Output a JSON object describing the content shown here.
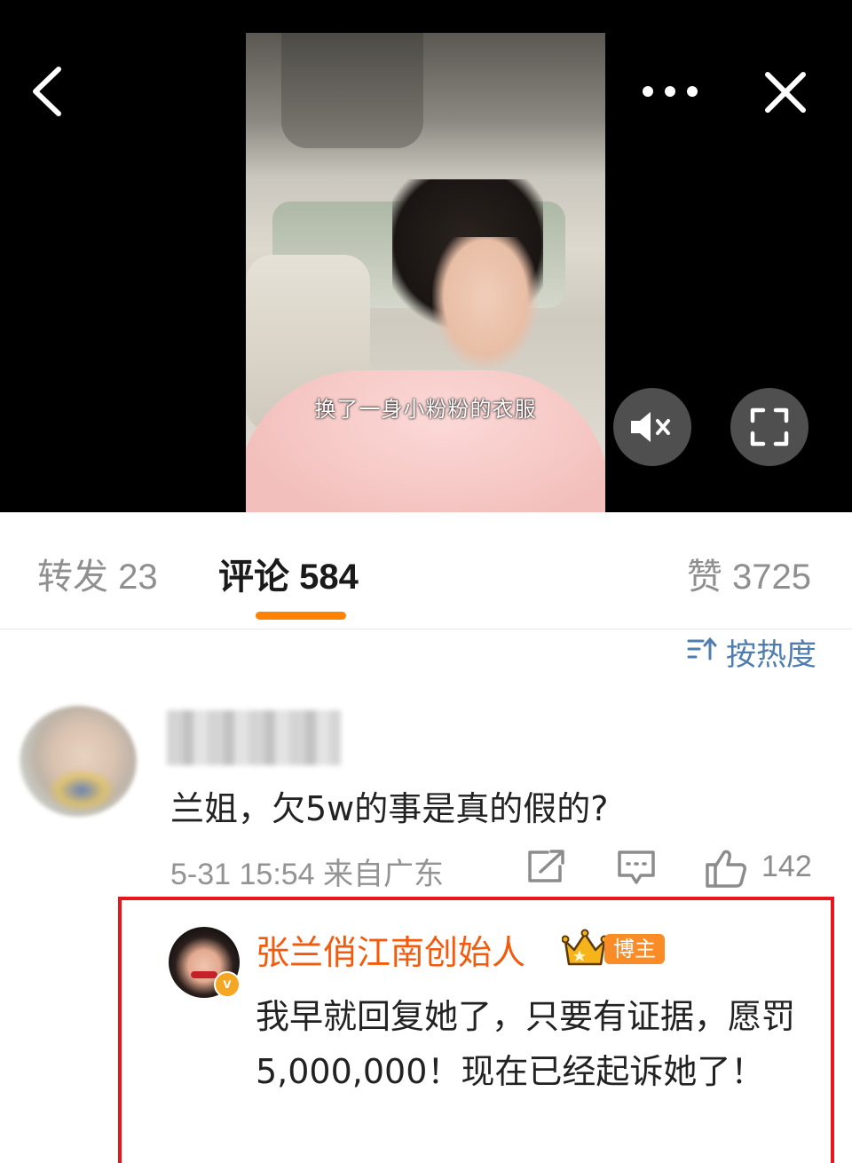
{
  "video": {
    "caption": "换了一身小粉粉的衣服",
    "icons": {
      "back": "chevron-left-icon",
      "more": "more-dots-icon",
      "close": "close-icon",
      "mute": "speaker-muted-icon",
      "fullscreen": "fullscreen-icon"
    }
  },
  "tabs": [
    {
      "label": "转发 23",
      "active": false
    },
    {
      "label": "评论 584",
      "active": true
    },
    {
      "label": "赞 3725",
      "active": false
    }
  ],
  "sort": {
    "label": "按热度",
    "icon": "sort-icon"
  },
  "comment": {
    "text": "兰姐，欠5w的事是真的假的?",
    "meta": "5-31 15:54  来自广东",
    "like_count": "142"
  },
  "reply": {
    "username": "张兰俏江南创始人",
    "badge": "博主",
    "verified": "v",
    "text": "我早就回复她了，只要有证据，愿罚5,000,000！现在已经起诉她了！"
  },
  "colors": {
    "accent": "#ff8200",
    "link_blue": "#507daf",
    "highlight_box": "#e8161b",
    "username_orange": "#f35a0c"
  }
}
